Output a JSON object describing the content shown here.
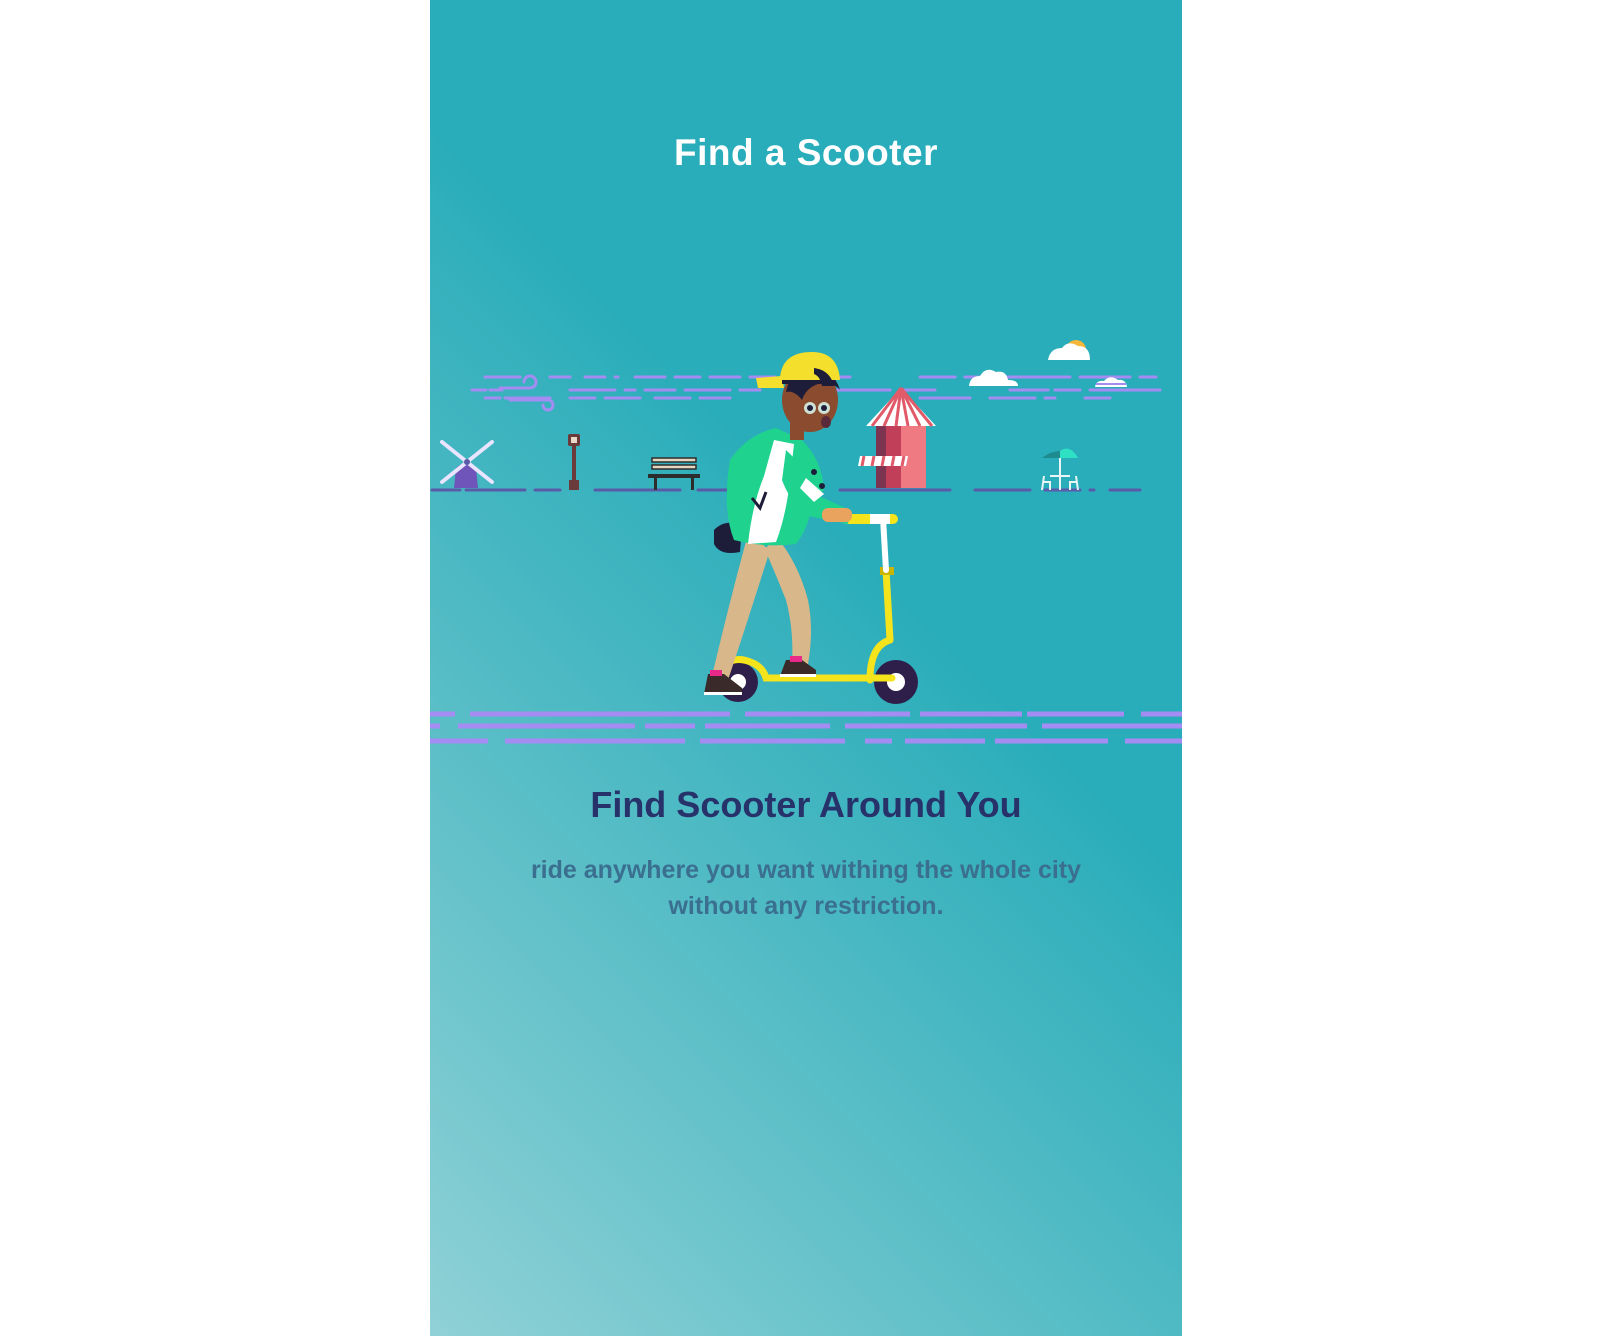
{
  "screen": {
    "title": "Find a Scooter",
    "headline": "Find Scooter Around You",
    "description": "ride anywhere you want withing the whole city without any restriction."
  },
  "illustration": {
    "scene": "person-riding-kick-scooter",
    "elements": [
      "windmill-icon",
      "street-lamp-icon",
      "park-bench-icon",
      "striped-kiosk-icon",
      "cafe-umbrella-table-icon",
      "cloud-icon",
      "sun-behind-cloud-icon",
      "wind-gust-icon"
    ]
  },
  "colors": {
    "background_top": "#2aadba",
    "background_bottom": "#8fd1d6",
    "title_text": "#ffffff",
    "headline_text": "#27316a",
    "description_text": "#3b6f8f",
    "road_lines": "#a58cf2",
    "scooter": "#f5e31c",
    "jacket": "#1fd38f",
    "cap": "#f5df2d",
    "kiosk": "#e05a6a"
  }
}
